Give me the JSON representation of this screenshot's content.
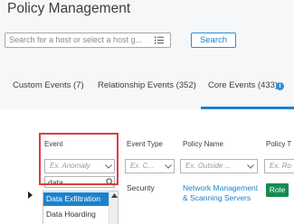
{
  "app": {
    "title": "Policy Management"
  },
  "search": {
    "placeholder": "Search for a host or select a host g...",
    "button_label": "Search"
  },
  "tabs": [
    {
      "label": "Custom Events (7)"
    },
    {
      "label": "Relationship Events (352)"
    },
    {
      "label": "Core Events (433)",
      "active": true
    }
  ],
  "tab_info_icon": "i",
  "table": {
    "columns": [
      {
        "header": "Event",
        "filter_placeholder": "Ex. Anomaly"
      },
      {
        "header": "Event Type",
        "filter_placeholder": "Ex. C..."
      },
      {
        "header": "Policy Name",
        "filter_placeholder": "Ex. Outside ..."
      },
      {
        "header": "Policy T",
        "filter_placeholder": "Ex. Ro"
      }
    ],
    "event_search_value": "data",
    "dropdown_options": [
      "Data Exfiltration",
      "Data Hoarding"
    ],
    "row": {
      "event_type": "Security",
      "policy_name_line1": "Network Management",
      "policy_name_line2": "& Scanning Servers",
      "policy_type": "Role"
    }
  },
  "colors": {
    "accent": "#1b82cc",
    "highlight": "#e23b3b",
    "role_badge": "#178a52"
  }
}
